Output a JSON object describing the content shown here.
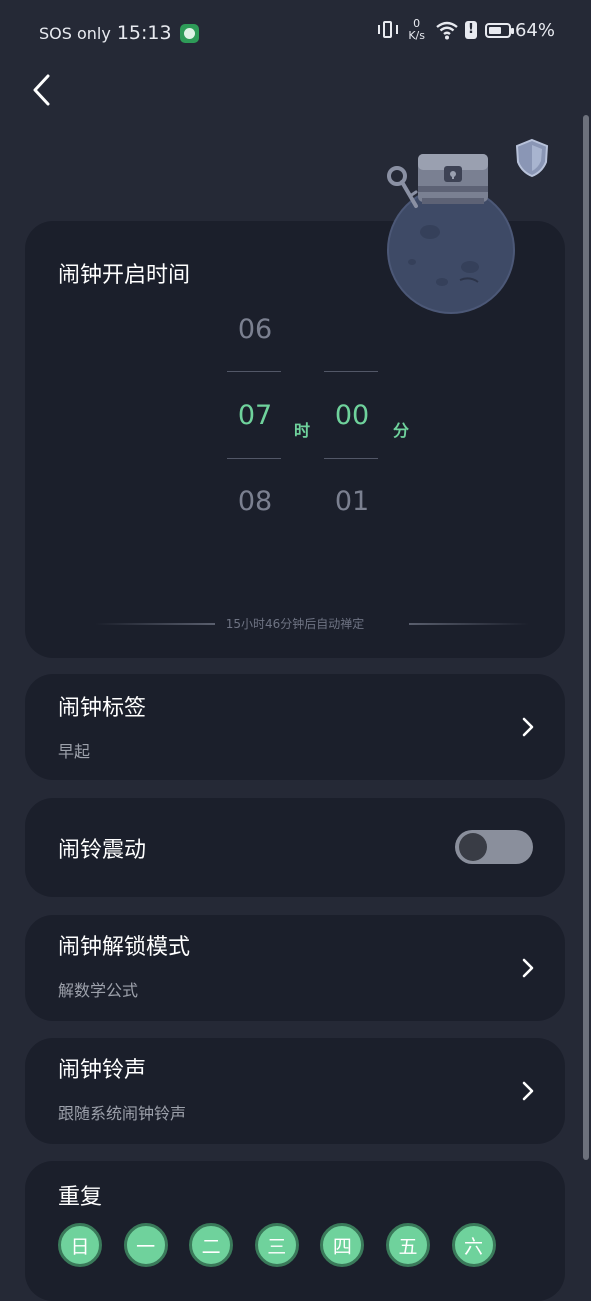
{
  "status_bar": {
    "carrier": "SOS only",
    "time": "15:13",
    "speed_value": "0",
    "speed_unit": "K/s",
    "battery": "64%",
    "battery_level": 0.64
  },
  "alarm_time": {
    "title": "闹钟开启时间",
    "hours": {
      "prev": "06",
      "selected": "07",
      "next": "08",
      "unit": "时"
    },
    "minutes": {
      "prev": "",
      "selected": "00",
      "next": "01",
      "unit": "分"
    },
    "hint": "15小时46分钟后自动禅定"
  },
  "label_card": {
    "title": "闹钟标签",
    "value": "早起"
  },
  "vibration_card": {
    "title": "闹铃震动",
    "enabled": false
  },
  "unlock_card": {
    "title": "闹钟解锁模式",
    "value": "解数学公式"
  },
  "ringtone_card": {
    "title": "闹钟铃声",
    "value": "跟随系统闹钟铃声"
  },
  "repeat_card": {
    "title": "重复",
    "days": [
      "日",
      "一",
      "二",
      "三",
      "四",
      "五",
      "六"
    ]
  },
  "colors": {
    "accent": "#6fd29c",
    "background": "#252936",
    "card": "#1b1f2b"
  },
  "icons": {
    "back": "back-arrow-icon",
    "chevron": "chevron-right-icon",
    "shield": "shield-badge-icon",
    "mascot": "treasure-chest-planet-illustration"
  }
}
